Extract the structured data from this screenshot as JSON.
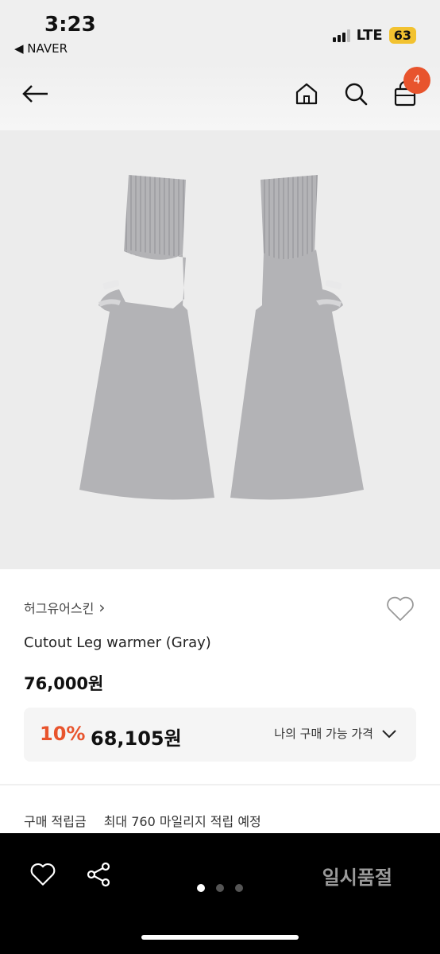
{
  "status_bar": {
    "time": "3:23",
    "back_app": "◀ NAVER",
    "network": "LTE",
    "battery": "63"
  },
  "nav": {
    "cart_count": "4"
  },
  "product": {
    "brand": "허그유어스킨",
    "brand_arrow": "›",
    "name": "Cutout Leg warmer (Gray)",
    "price": "76,000원",
    "discount_rate": "10%",
    "discount_price": "68,105원",
    "my_price_label": "나의 구매 가능 가격",
    "points_label": "구매 적립금",
    "points_text": "최대 760 마일리지 적립 예정"
  },
  "bottom_bar": {
    "soldout_label": "일시품절",
    "page_count": 3,
    "active_page": 1
  },
  "colors": {
    "accent": "#e8542d",
    "image_bg": "#ececec",
    "product": "#b3b3b6"
  }
}
